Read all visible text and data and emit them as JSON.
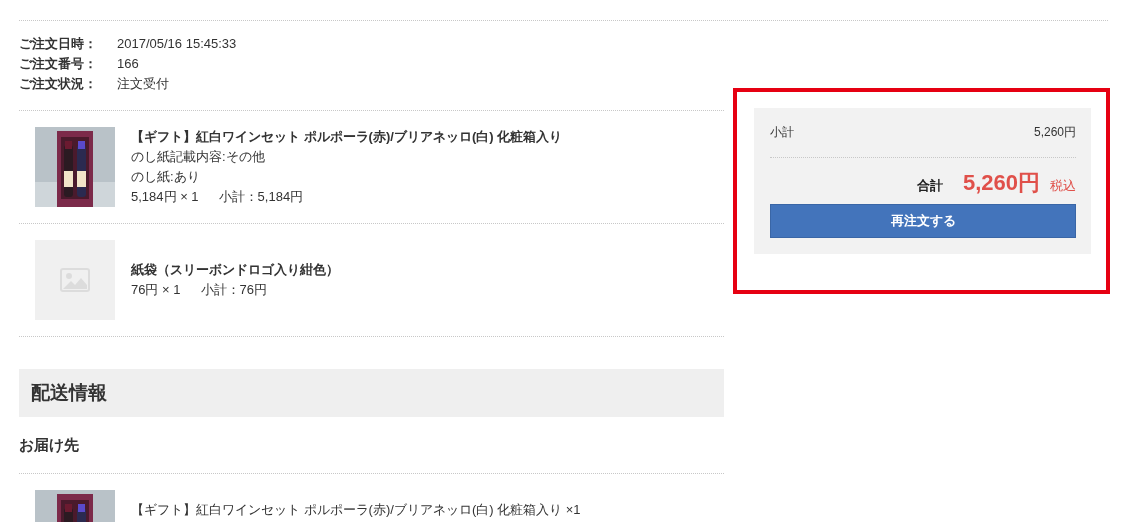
{
  "order_info": [
    {
      "label": "ご注文日時：",
      "value": "2017/05/16 15:45:33"
    },
    {
      "label": "ご注文番号：",
      "value": "166"
    },
    {
      "label": "ご注文状況：",
      "value": "注文受付"
    }
  ],
  "items": [
    {
      "kind": "picture",
      "title": "【ギフト】紅白ワインセット ポルポーラ(赤)/ブリアネッロ(白) 化粧箱入り",
      "details": [
        "のし紙記載内容:その他",
        "のし紙:あり"
      ],
      "price_qty": "5,184円 × 1",
      "subtotal": "小計：5,184円"
    },
    {
      "kind": "placeholder",
      "title": "紙袋（スリーボンドロゴ入り紺色）",
      "price_qty": "76円 × 1",
      "subtotal": "小計：76円"
    }
  ],
  "shipping": {
    "heading": "配送情報",
    "subheading": "お届け先",
    "items": [
      {
        "kind": "picture",
        "title": "【ギフト】紅白ワインセット ポルポーラ(赤)/ブリアネッロ(白) 化粧箱入り ×1"
      }
    ]
  },
  "summary": {
    "highlighted": true,
    "subtotal_label": "小計",
    "subtotal_value": "5,260円",
    "total_label": "合計",
    "total_value": "5,260円",
    "tax_note": "税込",
    "button": "再注文する"
  }
}
